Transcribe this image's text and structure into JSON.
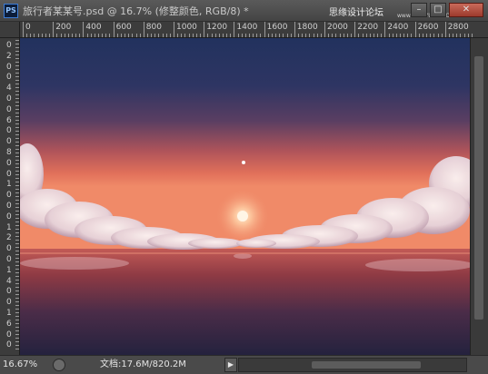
{
  "window": {
    "app_icon": "PS",
    "title": "旅行者某某号.psd @ 16.7% (修整颜色, RGB/8) *",
    "watermark": "思缘设计论坛",
    "watermark_url": "www.MISSYUAN.COM",
    "buttons": [
      "minimize-icon",
      "maximize-icon",
      "close-icon"
    ]
  },
  "ruler_top": {
    "labels": [
      "0",
      "200",
      "400",
      "600",
      "800",
      "1000",
      "1200",
      "1400",
      "1600",
      "1800",
      "2000",
      "2200",
      "2400",
      "2600",
      "2800"
    ]
  },
  "ruler_left": {
    "labels": [
      "0",
      "2",
      "0",
      "0",
      "4",
      "0",
      "0",
      "6",
      "0",
      "0",
      "8",
      "0",
      "0",
      "1",
      "0",
      "0",
      "0",
      "1",
      "2",
      "0",
      "0",
      "1",
      "4",
      "0",
      "0",
      "1",
      "6",
      "0",
      "0"
    ]
  },
  "canvas": {
    "content": "sunset-sky-clouds-reflection-image",
    "colors": {
      "sky_top": "#22325e",
      "sky_mid": "#5a3e62",
      "horizon": "#e1705a",
      "sea": "#6e2e3a",
      "sea_bottom": "#2a2446",
      "cloud": "#efe6ea",
      "sun": "#fff2d8"
    }
  },
  "status": {
    "zoom": "16.67%",
    "doc_info": "文档:17.6M/820.2M",
    "menu_arrow": "▶"
  }
}
